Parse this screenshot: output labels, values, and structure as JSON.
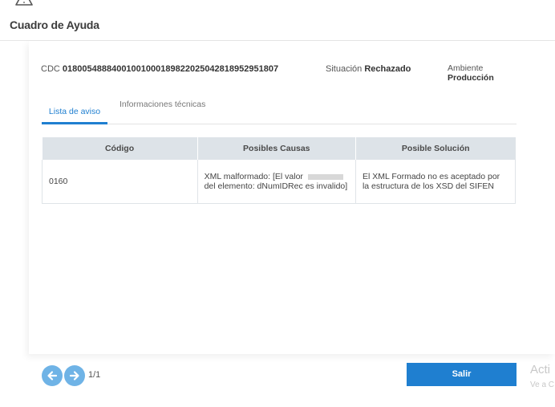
{
  "dialog": {
    "title": "Cuadro de Ayuda"
  },
  "summary": {
    "cdc_label": "CDC",
    "cdc_value": "01800548884001001000189822025042818952951807",
    "situacion_label": "Situación",
    "situacion_value": "Rechazado",
    "ambiente_label": "Ambiente",
    "ambiente_value": "Producción"
  },
  "tabs": [
    {
      "label": "Lista de aviso",
      "active": true
    },
    {
      "label": "Informaciones técnicas",
      "active": false
    }
  ],
  "table": {
    "headers": [
      "Código",
      "Posibles Causas",
      "Posible Solución"
    ],
    "rows": [
      {
        "codigo": "0160",
        "causa_before": "XML malformado: [El valor",
        "causa_after": "del elemento: dNumIDRec es invalido]",
        "solucion": "El XML Formado no es aceptado por la estructura de los XSD del SIFEN"
      }
    ]
  },
  "pager": {
    "prev_icon": "arrow-left-icon",
    "next_icon": "arrow-right-icon",
    "page_text": "1/1"
  },
  "footer": {
    "salir_label": "Salir"
  },
  "watermark": {
    "title": "Acti",
    "subtitle": "Ve a C"
  },
  "colors": {
    "accent": "#1f7fd0",
    "nav_button": "#6fb3e6",
    "table_header_bg": "#dde3e8"
  },
  "icons": {
    "header_icon": "warning-triangle-icon"
  }
}
